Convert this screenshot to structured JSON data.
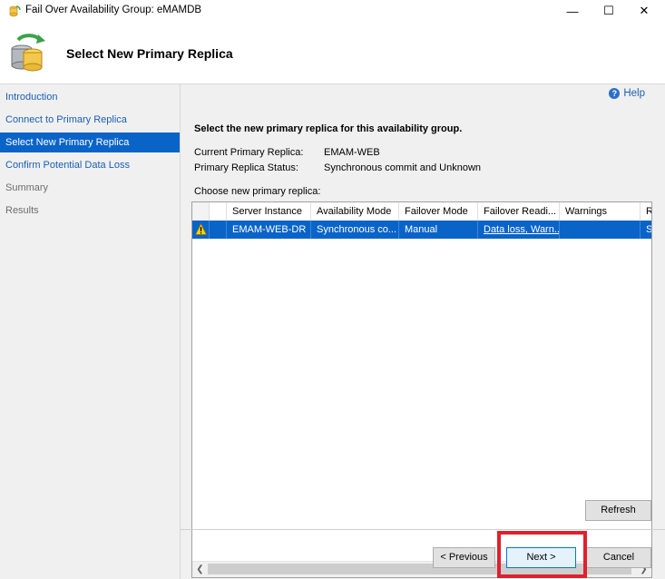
{
  "window": {
    "title": "Fail Over Availability Group: eMAMDB",
    "minimize_glyph": "—",
    "maximize_glyph": "☐",
    "close_glyph": "✕"
  },
  "header": {
    "title": "Select New Primary Replica",
    "icon": "database-refresh-icon"
  },
  "nav": {
    "items": [
      {
        "label": "Introduction",
        "state": "link"
      },
      {
        "label": "Connect to Primary Replica",
        "state": "link"
      },
      {
        "label": "Select New Primary Replica",
        "state": "selected"
      },
      {
        "label": "Confirm Potential Data Loss",
        "state": "link"
      },
      {
        "label": "Summary",
        "state": "disabled"
      },
      {
        "label": "Results",
        "state": "disabled"
      }
    ]
  },
  "main": {
    "help_label": "Help",
    "instruction": "Select the new primary replica for this availability group.",
    "current_primary_label": "Current Primary Replica:",
    "current_primary_value": "EMAM-WEB",
    "status_label": "Primary Replica Status:",
    "status_value": "Synchronous commit and Unknown",
    "choose_label": "Choose new primary replica:"
  },
  "grid": {
    "columns": [
      "Server Instance",
      "Availability Mode",
      "Failover Mode",
      "Failover Readi...",
      "Warnings",
      "R"
    ],
    "rows": [
      {
        "warning_icon": "warning-icon",
        "checked": true,
        "server_instance": "EMAM-WEB-DR",
        "availability_mode": "Synchronous co...",
        "failover_mode": "Manual",
        "failover_readiness": "Data loss, Warn...",
        "warnings": "",
        "r": "Se"
      }
    ]
  },
  "buttons": {
    "refresh": "Refresh",
    "previous": "< Previous",
    "next": "Next >",
    "cancel": "Cancel"
  },
  "colors": {
    "selection": "#0a64c8",
    "link": "#1a5fb4",
    "highlight": "#e0202e"
  }
}
